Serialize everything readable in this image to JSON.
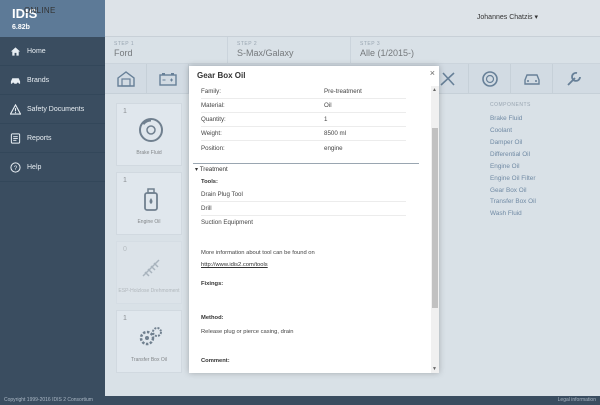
{
  "app": {
    "name": "IDIS",
    "name_suffix": "ONLINE",
    "version": "6.82b"
  },
  "sidebar": {
    "items": [
      {
        "label": "Home",
        "icon": "home-icon"
      },
      {
        "label": "Brands",
        "icon": "car-icon"
      },
      {
        "label": "Safety Documents",
        "icon": "warning-icon"
      },
      {
        "label": "Reports",
        "icon": "reports-icon"
      },
      {
        "label": "Help",
        "icon": "help-icon"
      }
    ]
  },
  "header": {
    "user": "Johannes Chatzis ▾"
  },
  "steps": [
    {
      "label": "STEP 1",
      "value": "Ford"
    },
    {
      "label": "STEP 2",
      "value": "S-Max/Galaxy"
    },
    {
      "label": "STEP 3",
      "value": "Alle (1/2015-)"
    }
  ],
  "tiles": [
    {
      "count": "1",
      "name": "Brake Fluid"
    },
    {
      "count": "1",
      "name": "Engine Oil"
    },
    {
      "count": "0",
      "name": "ESP-Holzlose Drehmoment"
    },
    {
      "count": "1",
      "name": "Transfer Box Oil"
    }
  ],
  "components": {
    "heading": "COMPONENTS",
    "items": [
      "Brake Fluid",
      "Coolant",
      "Damper Oil",
      "Differential Oil",
      "Engine Oil",
      "Engine Oil Filter",
      "Gear Box Oil",
      "Transfer Box Oil",
      "Wash Fluid"
    ]
  },
  "modal": {
    "title": "Gear Box Oil",
    "close": "×",
    "properties": [
      {
        "key": "Family:",
        "value": "Pre-treatment"
      },
      {
        "key": "Material:",
        "value": "Oil"
      },
      {
        "key": "Quantity:",
        "value": "1"
      },
      {
        "key": "Weight:",
        "value": "8500 ml"
      },
      {
        "key": "Position:",
        "value": "engine"
      }
    ],
    "treatment_heading": "▾ Treatment",
    "tools_label": "Tools:",
    "tools": [
      "Drain Plug Tool",
      "Drill",
      "Suction Equipment"
    ],
    "more_info": "More information about tool can be found on",
    "more_info_link": "http://www.idis2.com/tools",
    "fixings_label": "Fixings:",
    "method_label": "Method:",
    "method_text": "Release plug or pierce casing, drain",
    "comment_label": "Comment:"
  },
  "footer": {
    "left": "Copyright 1999-2016 IDIS 2 Consortium",
    "right": "Legal information"
  }
}
